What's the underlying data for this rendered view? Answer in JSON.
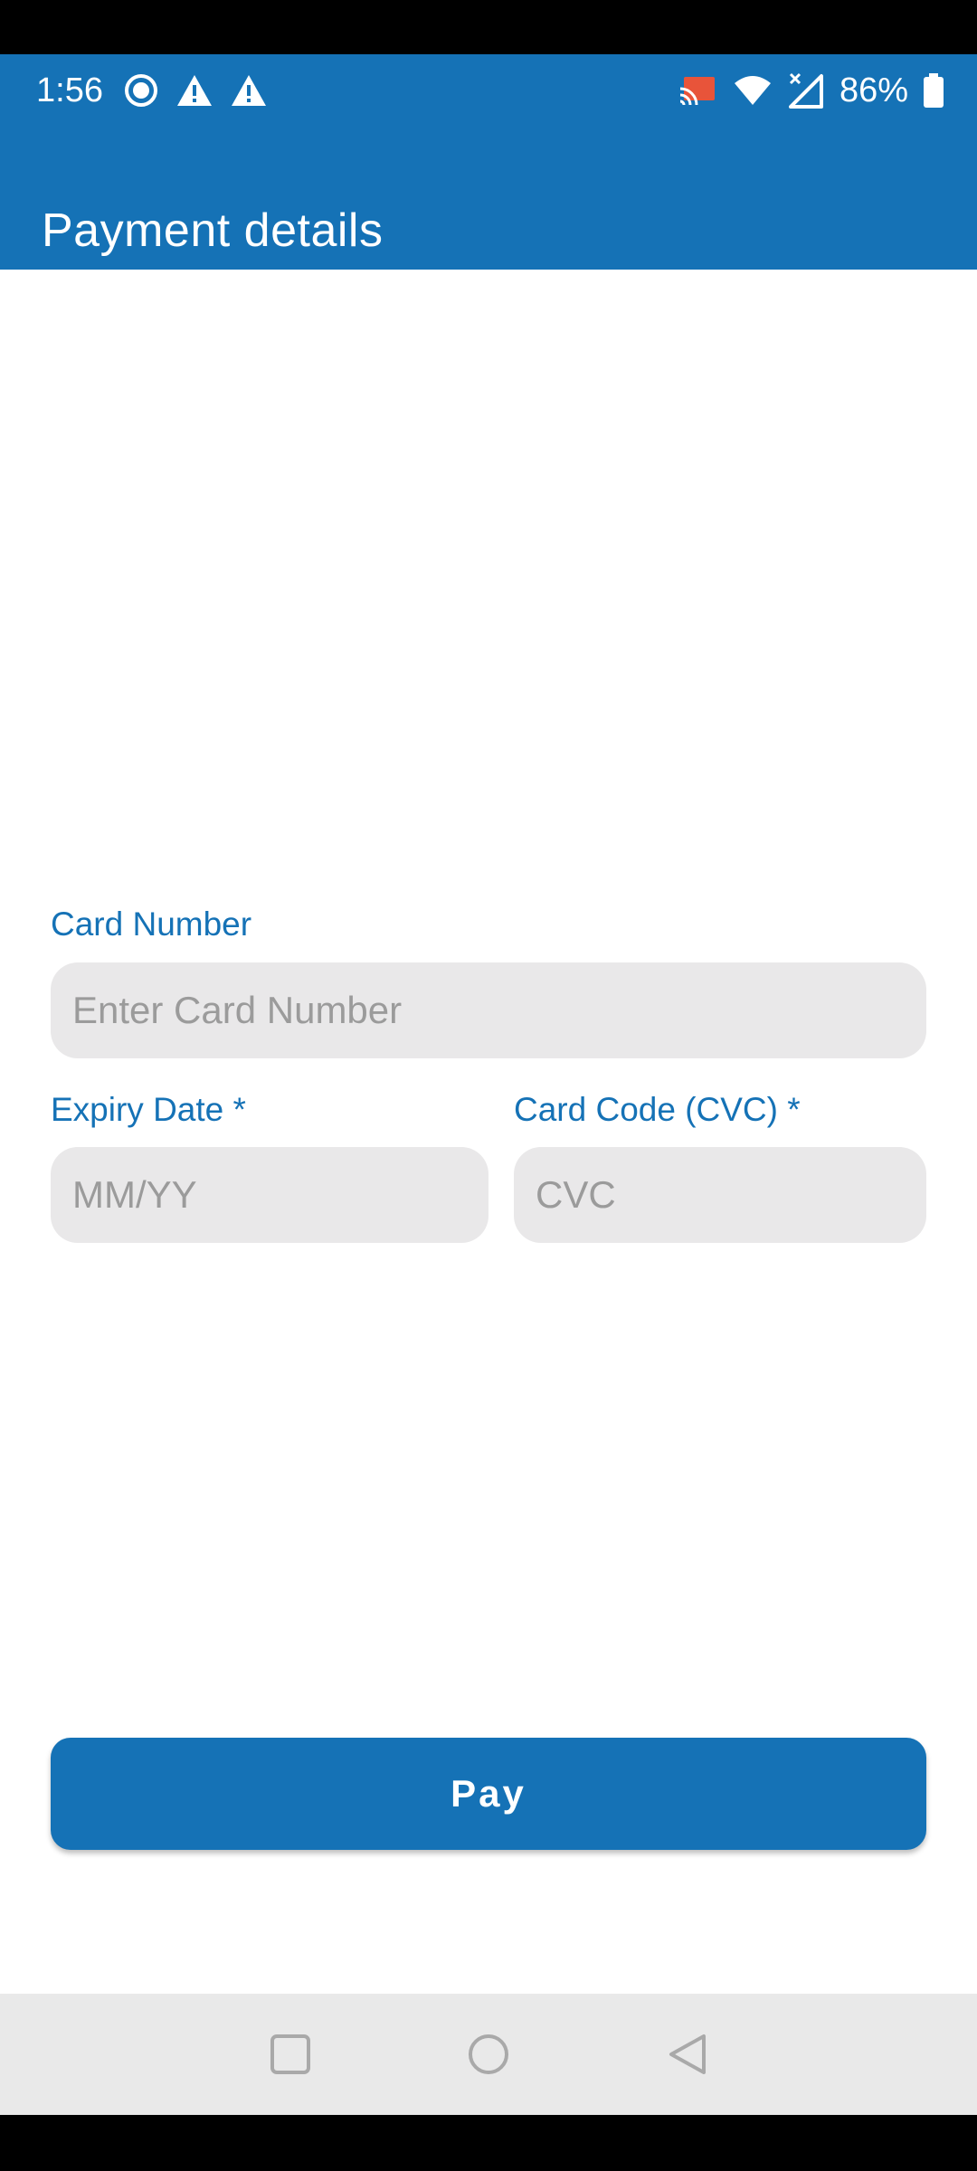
{
  "status_bar": {
    "time": "1:56",
    "battery": "86%",
    "left_icons": [
      "record-icon",
      "warning-icon",
      "warning-icon"
    ],
    "right_icons": [
      "cast-icon",
      "wifi-icon",
      "signal-icon",
      "battery-icon"
    ]
  },
  "app_bar": {
    "title": "Payment details"
  },
  "form": {
    "card_number": {
      "label": "Card Number",
      "placeholder": "Enter Card Number",
      "value": ""
    },
    "expiry": {
      "label": "Expiry Date *",
      "placeholder": "MM/YY",
      "value": ""
    },
    "cvc": {
      "label": "Card Code (CVC) *",
      "placeholder": "CVC",
      "value": ""
    }
  },
  "pay_button": {
    "label": "Pay"
  },
  "nav_bar": {
    "buttons": [
      "recents-icon",
      "home-icon",
      "back-icon"
    ]
  },
  "colors": {
    "primary": "#1572b6",
    "input_background": "#e9e8e9",
    "placeholder": "#9b9b9b",
    "nav_background": "#e9e9e9",
    "cast_accent": "#e8543a"
  }
}
